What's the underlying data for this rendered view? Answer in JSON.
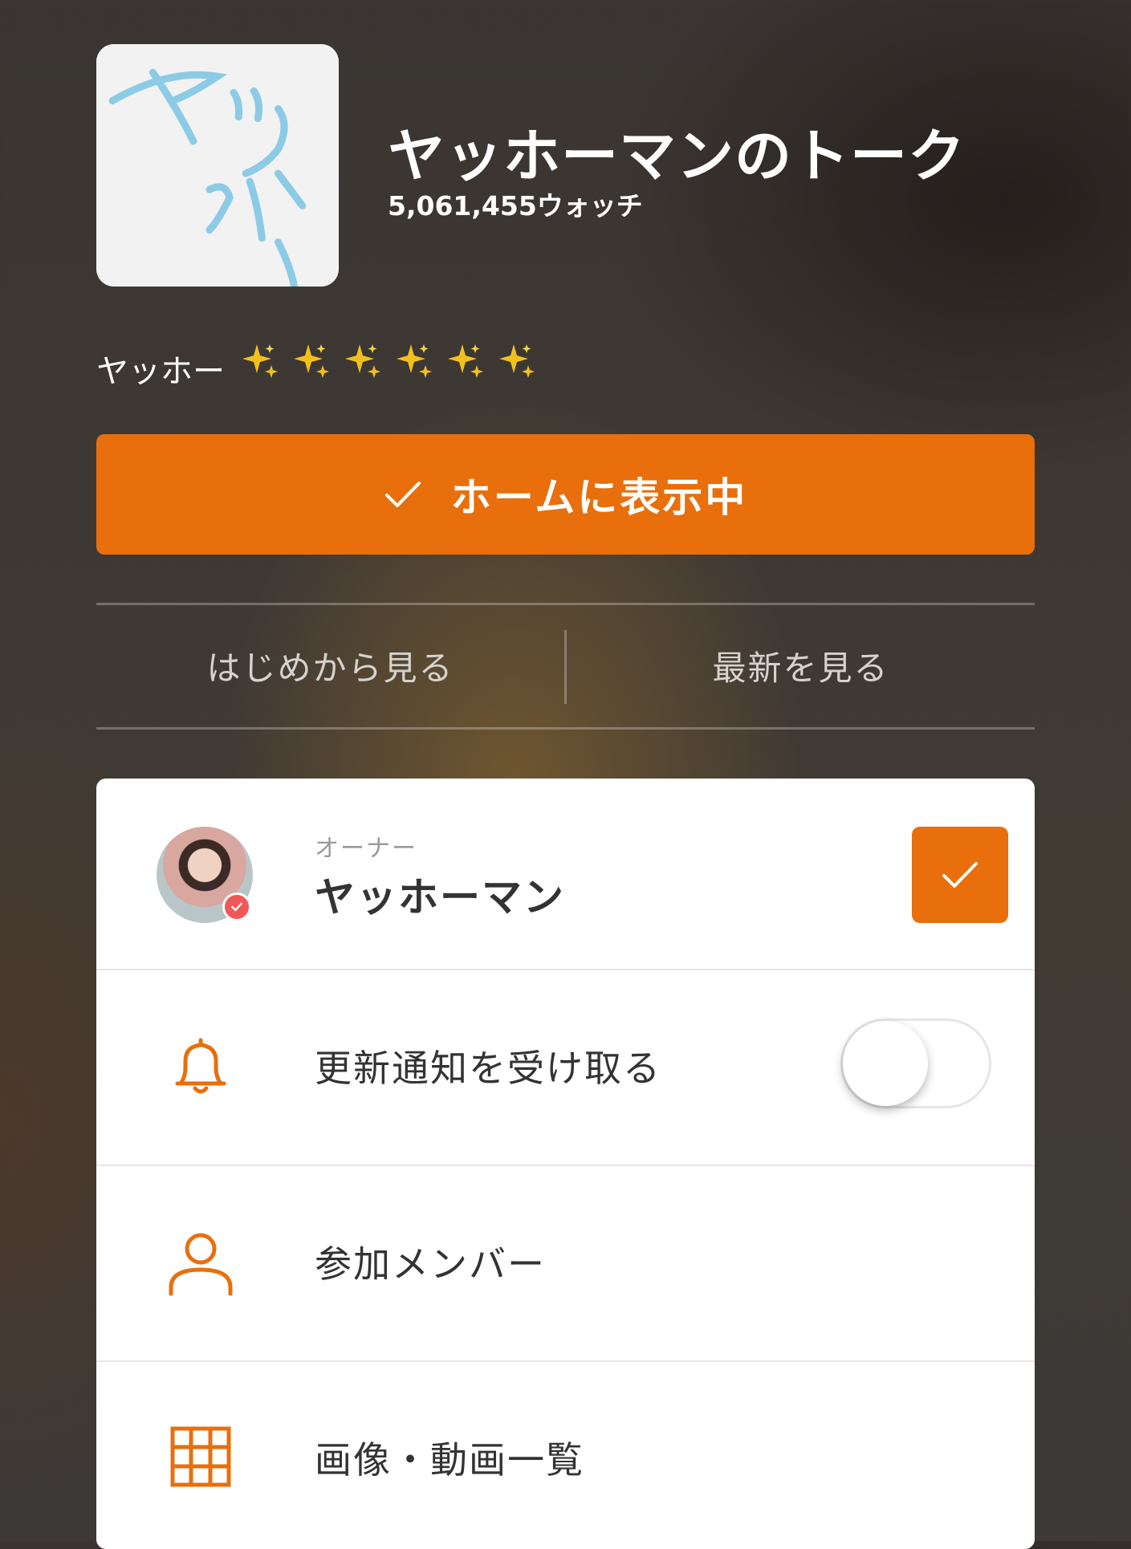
{
  "header": {
    "title": "ヤッホーマンのトーク",
    "watch_count": "5,061,455ウォッチ",
    "description": "ヤッホー",
    "sparkle_count": 6
  },
  "actions": {
    "home_button_label": "ホームに表示中",
    "view_from_start": "はじめから見る",
    "view_latest": "最新を見る"
  },
  "owner": {
    "caption": "オーナー",
    "name": "ヤッホーマン",
    "verified": true
  },
  "menu": {
    "notifications_label": "更新通知を受け取る",
    "notifications_enabled": false,
    "members_label": "参加メンバー",
    "media_label": "画像・動画一覧"
  },
  "colors": {
    "accent": "#e86f0c",
    "card_background": "#ffffff",
    "page_background": "#3c3835"
  }
}
